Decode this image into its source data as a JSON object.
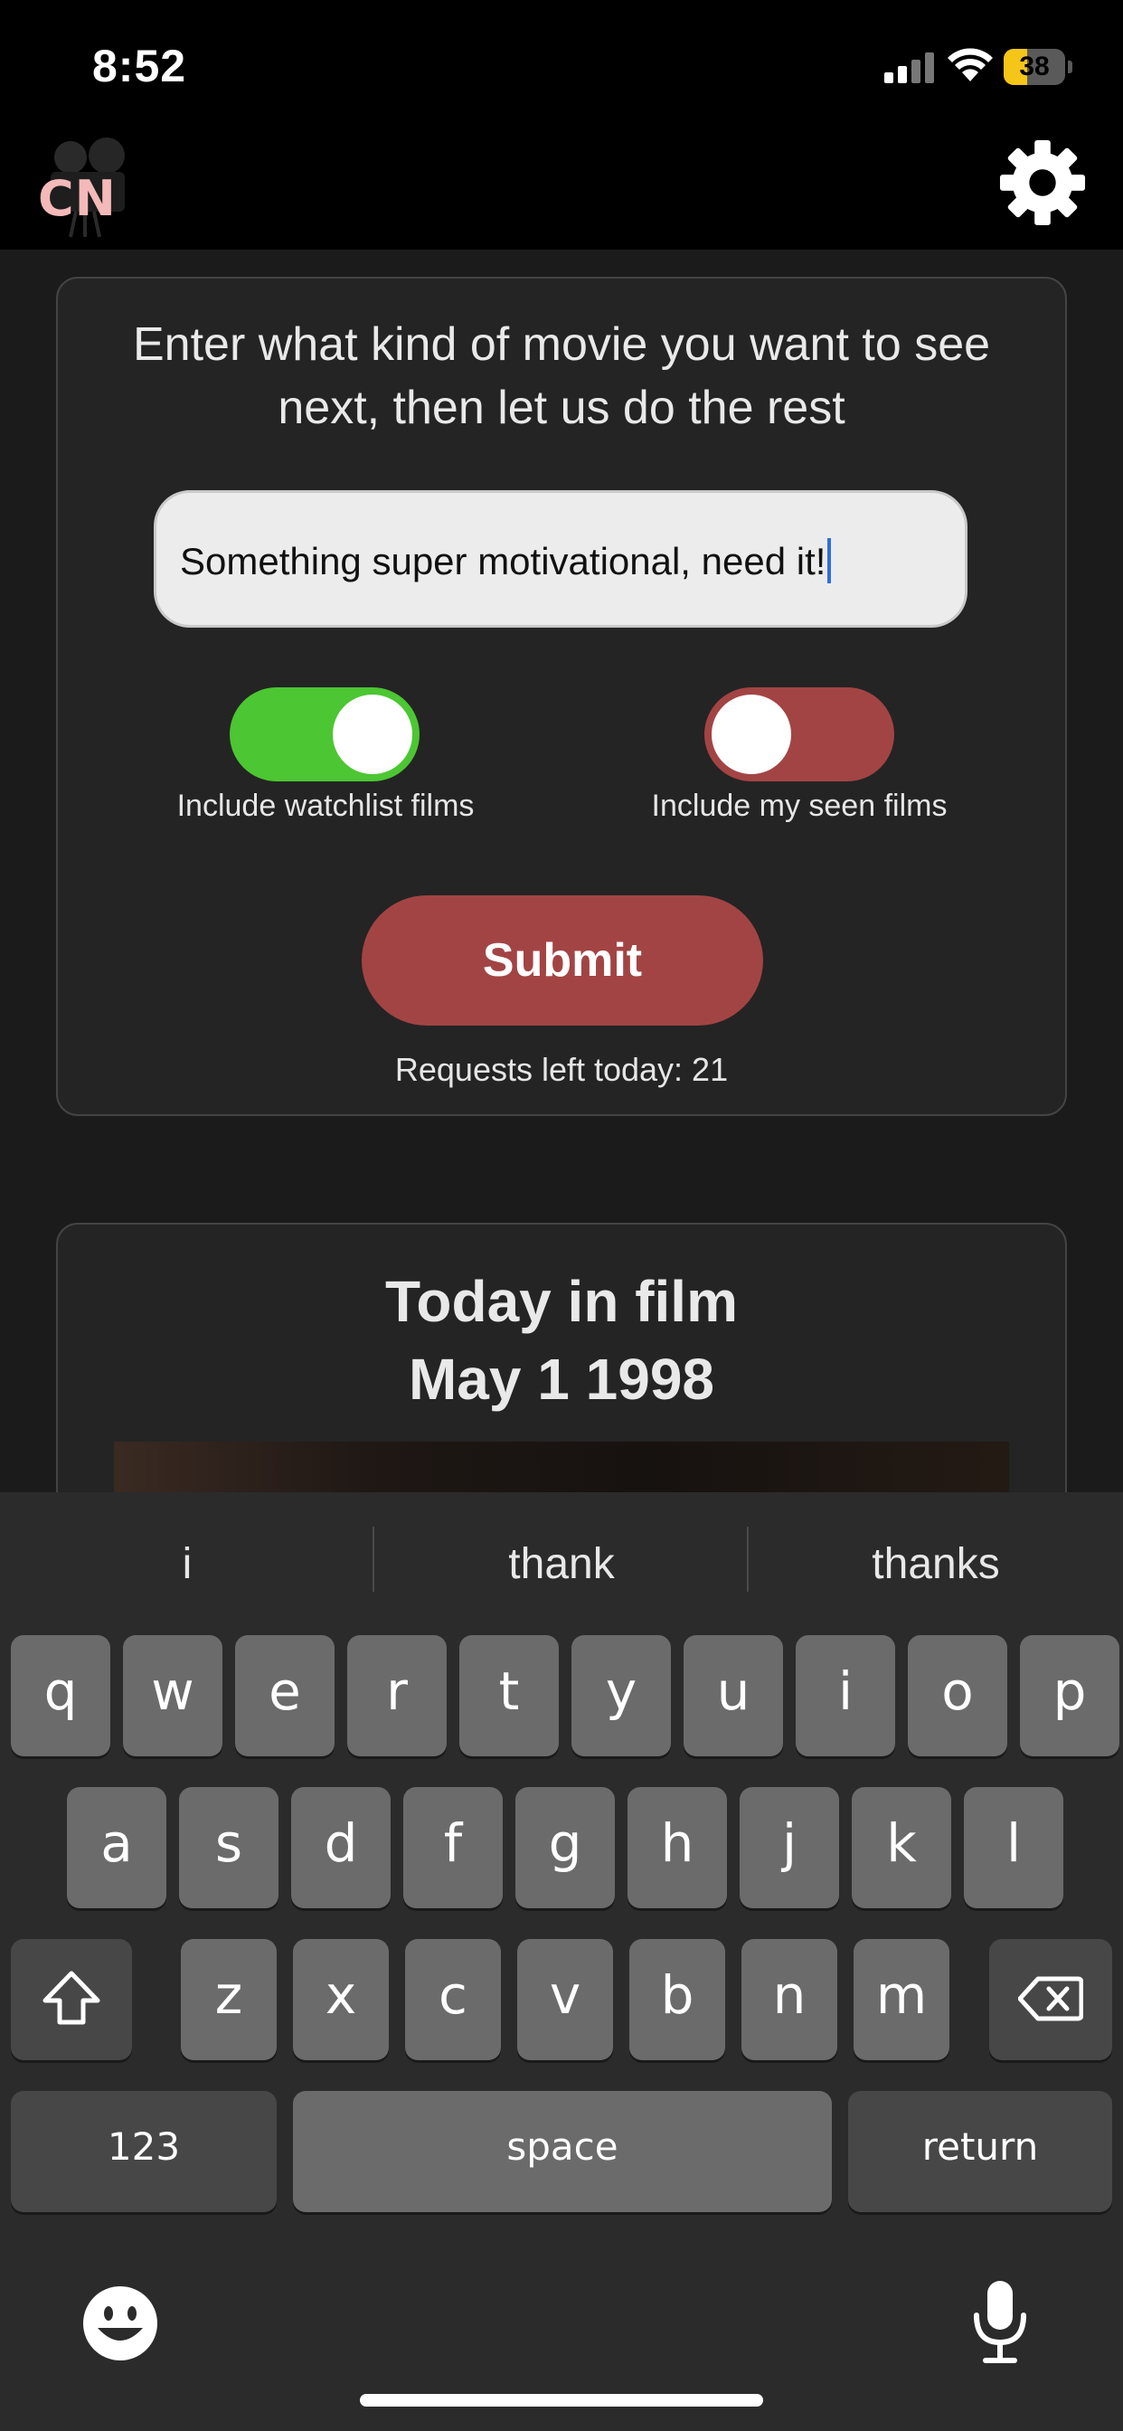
{
  "status_bar": {
    "time": "8:52",
    "battery_level": "38",
    "battery_percent": 38,
    "battery_color": "#f5c518"
  },
  "app": {
    "logo_text": "CN",
    "settings_icon": "gear-icon"
  },
  "prompt_card": {
    "prompt": "Enter what kind of movie you want to see next, then let us do the rest",
    "input_value": "Something super motivational, need it!",
    "toggle_watchlist": {
      "label": "Include watchlist films",
      "on": true,
      "color": "#4cc632"
    },
    "toggle_seen": {
      "label": "Include my seen films",
      "on": false,
      "color": "#a34444"
    },
    "submit_label": "Submit",
    "requests_left": "Requests left today: 21"
  },
  "today_card": {
    "title_line1": "Today in film",
    "title_line2": "May 1 1998"
  },
  "keyboard": {
    "suggestions": [
      "i",
      "thank",
      "thanks"
    ],
    "row1": [
      "q",
      "w",
      "e",
      "r",
      "t",
      "y",
      "u",
      "i",
      "o",
      "p"
    ],
    "row2": [
      "a",
      "s",
      "d",
      "f",
      "g",
      "h",
      "j",
      "k",
      "l"
    ],
    "row3": [
      "z",
      "x",
      "c",
      "v",
      "b",
      "n",
      "m"
    ],
    "numbers_label": "123",
    "space_label": "space",
    "return_label": "return",
    "shift_icon": "shift-icon",
    "delete_icon": "delete-icon",
    "emoji_icon": "emoji-icon",
    "mic_icon": "microphone-icon"
  },
  "colors": {
    "accent_red": "#a34444",
    "accent_green": "#4cc632",
    "background": "#1b1b1b",
    "card": "#242424"
  }
}
